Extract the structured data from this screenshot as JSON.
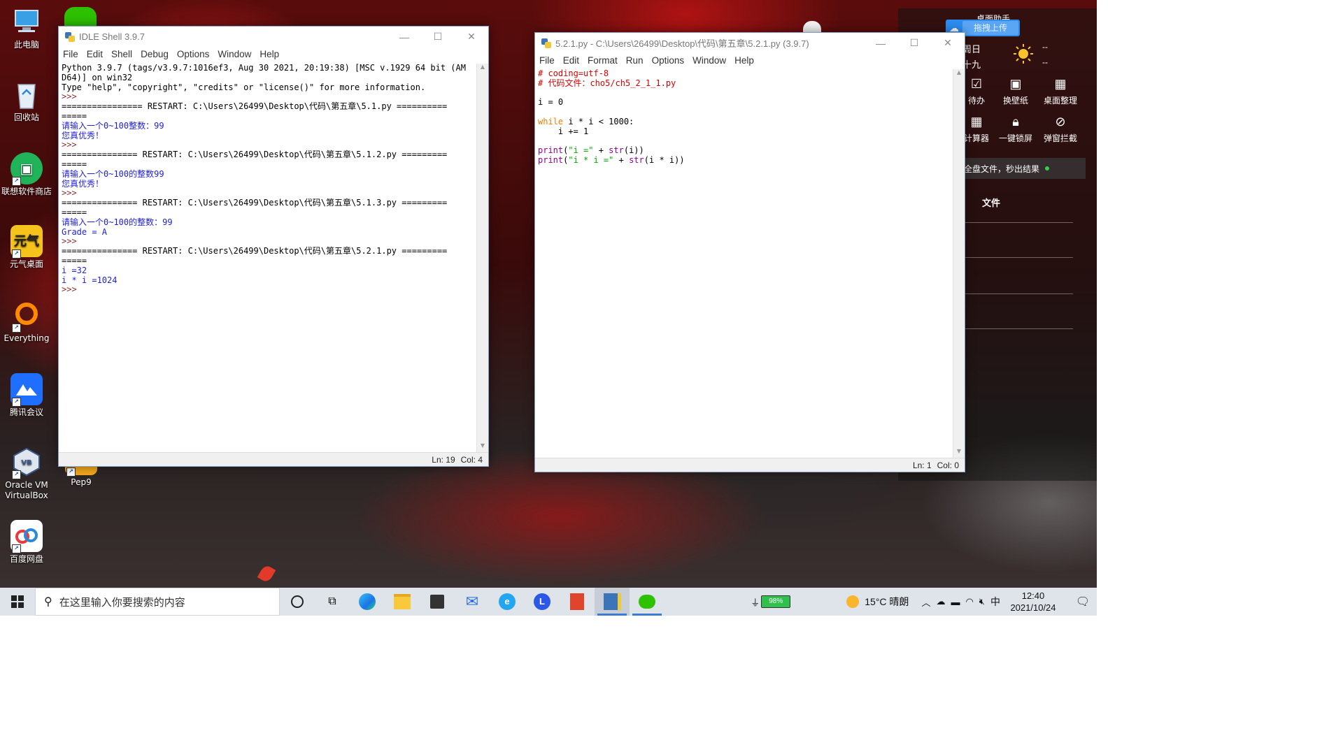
{
  "desktop": {
    "icons": [
      {
        "label": "此电脑"
      },
      {
        "label": "回收站"
      },
      {
        "label": "联想软件商店"
      },
      {
        "label": "元气桌面"
      },
      {
        "label": "Everything"
      },
      {
        "label": "腾讯会议"
      },
      {
        "label": "Oracle VM VirtualBox"
      },
      {
        "label": "Pep9"
      },
      {
        "label": "百度网盘"
      }
    ]
  },
  "shell": {
    "title": "IDLE Shell 3.9.7",
    "menu": [
      "File",
      "Edit",
      "Shell",
      "Debug",
      "Options",
      "Window",
      "Help"
    ],
    "lines": [
      {
        "text": "Python 3.9.7 (tags/v3.9.7:1016ef3, Aug 30 2021, 20:19:38) [MSC v.1929 64 bit (AM",
        "style": ""
      },
      {
        "text": "D64)] on win32",
        "style": ""
      },
      {
        "text": "Type \"help\", \"copyright\", \"credits\" or \"license()\" for more information.",
        "style": ""
      },
      {
        "text": ">>> ",
        "style": "pr"
      },
      {
        "text": "================ RESTART: C:\\Users\\26499\\Desktop\\代码\\第五章\\5.1.py ==========",
        "style": ""
      },
      {
        "text": "=====",
        "style": ""
      },
      {
        "text": "请输入一个0~100整数：99",
        "style": "blue"
      },
      {
        "text": "您真优秀！",
        "style": "blue"
      },
      {
        "text": ">>> ",
        "style": "pr"
      },
      {
        "text": "=============== RESTART: C:\\Users\\26499\\Desktop\\代码\\第五章\\5.1.2.py =========",
        "style": ""
      },
      {
        "text": "=====",
        "style": ""
      },
      {
        "text": "请输入一个0~100的整数99",
        "style": "blue"
      },
      {
        "text": "您真优秀！",
        "style": "blue"
      },
      {
        "text": ">>> ",
        "style": "pr"
      },
      {
        "text": "=============== RESTART: C:\\Users\\26499\\Desktop\\代码\\第五章\\5.1.3.py =========",
        "style": ""
      },
      {
        "text": "=====",
        "style": ""
      },
      {
        "text": "请输入一个0~100的整数：99",
        "style": "blue"
      },
      {
        "text": "Grade = A",
        "style": "blue"
      },
      {
        "text": ">>> ",
        "style": "pr"
      },
      {
        "text": "=============== RESTART: C:\\Users\\26499\\Desktop\\代码\\第五章\\5.2.1.py =========",
        "style": ""
      },
      {
        "text": "=====",
        "style": ""
      },
      {
        "text": "i =32",
        "style": "blue"
      },
      {
        "text": "i * i =1024",
        "style": "blue"
      },
      {
        "text": ">>> ",
        "style": "pr"
      }
    ],
    "status": {
      "ln": "Ln: 19",
      "col": "Col: 4"
    }
  },
  "editor": {
    "title": "5.2.1.py - C:\\Users\\26499\\Desktop\\代码\\第五章\\5.2.1.py (3.9.7)",
    "menu": [
      "File",
      "Edit",
      "Format",
      "Run",
      "Options",
      "Window",
      "Help"
    ],
    "lines": [
      [
        {
          "t": "# coding=utf-8",
          "c": "cm"
        }
      ],
      [
        {
          "t": "# 代码文件：cho5/ch5_2_1_1.py",
          "c": "cm"
        }
      ],
      [
        {
          "t": "",
          "c": ""
        }
      ],
      [
        {
          "t": "i = 0",
          "c": ""
        }
      ],
      [
        {
          "t": "",
          "c": ""
        }
      ],
      [
        {
          "t": "while",
          "c": "kw"
        },
        {
          "t": " i * i < 1000:",
          "c": ""
        }
      ],
      [
        {
          "t": "    i += 1",
          "c": ""
        }
      ],
      [
        {
          "t": "",
          "c": ""
        }
      ],
      [
        {
          "t": "print",
          "c": "bi"
        },
        {
          "t": "(",
          "c": ""
        },
        {
          "t": "\"i =\"",
          "c": "st"
        },
        {
          "t": " + ",
          "c": ""
        },
        {
          "t": "str",
          "c": "bi"
        },
        {
          "t": "(i))",
          "c": ""
        }
      ],
      [
        {
          "t": "print",
          "c": "bi"
        },
        {
          "t": "(",
          "c": ""
        },
        {
          "t": "\"i * i =\"",
          "c": "st"
        },
        {
          "t": " + ",
          "c": ""
        },
        {
          "t": "str",
          "c": "bi"
        },
        {
          "t": "(i * i))",
          "c": ""
        }
      ]
    ],
    "status": {
      "ln": "Ln: 1",
      "col": "Col: 0"
    }
  },
  "assistant": {
    "title": "桌面助手",
    "upload": "拖拽上传",
    "weekday": "周日",
    "lunar": "十九",
    "temp_hi": "--",
    "temp_lo": "--",
    "tools_row1": [
      "待办",
      "换壁纸",
      "桌面整理"
    ],
    "tools_row2": [
      "计算器",
      "一键锁屏",
      "弹窗拦截"
    ],
    "search_hint": "全盘文件，秒出结果",
    "files_label": "文件"
  },
  "taskbar": {
    "search_placeholder": "在这里输入你要搜索的内容",
    "battery": "98%",
    "weather": "15°C  晴朗",
    "ime": "中",
    "time": "12:40",
    "date": "2021/10/24"
  }
}
